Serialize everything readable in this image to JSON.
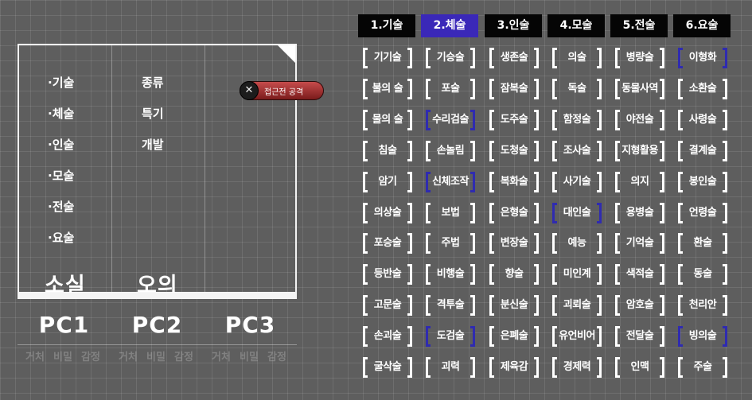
{
  "left_panel": {
    "left_items": [
      "·기술",
      "·체술",
      "·인술",
      "·모술",
      "·전술",
      "·요술"
    ],
    "right_items": [
      "종류",
      "특기",
      "개발"
    ],
    "labels": [
      "소실",
      "오의"
    ],
    "pcs": [
      "PC1",
      "PC2",
      "PC3"
    ],
    "ghost_text": [
      "거처",
      "비밀",
      "감정"
    ],
    "attack_label": "접근전 공격",
    "attack_icon": "crossed-swords-icon"
  },
  "tabs": [
    {
      "label": "1.기술",
      "active": false
    },
    {
      "label": "2.체술",
      "active": true
    },
    {
      "label": "3.인술",
      "active": false
    },
    {
      "label": "4.모술",
      "active": false
    },
    {
      "label": "5.전술",
      "active": false
    },
    {
      "label": "6.요술",
      "active": false
    }
  ],
  "skills": [
    [
      "기기술",
      "기승술",
      "생존술",
      "의술",
      "병량술",
      "이형화"
    ],
    [
      "불의 술",
      "포술",
      "잠복술",
      "독술",
      "동물사역",
      "소환술"
    ],
    [
      "물의 술",
      "수리검술",
      "도주술",
      "함정술",
      "야전술",
      "사령술"
    ],
    [
      "침술",
      "손놀림",
      "도청술",
      "조사술",
      "지형활용",
      "결계술"
    ],
    [
      "암기",
      "신체조작",
      "복화술",
      "사기술",
      "의지",
      "봉인술"
    ],
    [
      "의상술",
      "보법",
      "은형술",
      "대인술",
      "용병술",
      "언령술"
    ],
    [
      "포승술",
      "주법",
      "변장술",
      "예능",
      "기억술",
      "환술"
    ],
    [
      "등반술",
      "비행술",
      "향술",
      "미인계",
      "색적술",
      "동술"
    ],
    [
      "고문술",
      "격투술",
      "분신술",
      "괴뢰술",
      "암호술",
      "천리안"
    ],
    [
      "손괴술",
      "도검술",
      "은폐술",
      "유언비어",
      "전달술",
      "빙의술"
    ],
    [
      "굴삭술",
      "괴력",
      "제육감",
      "경제력",
      "인맥",
      "주술"
    ]
  ],
  "highlighted": [
    [
      0,
      5
    ],
    [
      2,
      1
    ],
    [
      4,
      1
    ],
    [
      5,
      3
    ],
    [
      9,
      1
    ],
    [
      9,
      5
    ]
  ],
  "colors": {
    "active_tab": "#3a28b8",
    "highlight_bracket": "#2f2bb0",
    "tab_bg": "#050505"
  }
}
